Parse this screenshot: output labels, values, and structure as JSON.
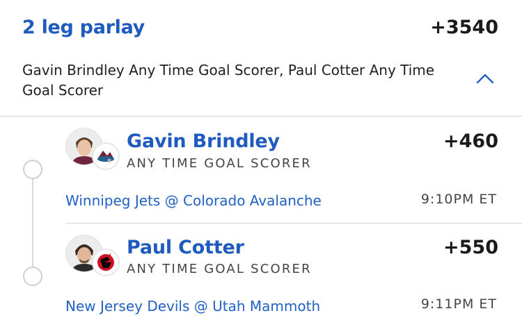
{
  "bet": {
    "title": "2 leg parlay",
    "odds": "+3540",
    "description": "Gavin Brindley Any Time Goal Scorer, Paul Cotter Any Time Goal Scorer"
  },
  "legs": [
    {
      "player": "Gavin Brindley",
      "market": "ANY TIME GOAL SCORER",
      "odds": "+460",
      "game": "Winnipeg Jets @ Colorado Avalanche",
      "time": "9:10PM ET",
      "team_logo": "colorado-avalanche-logo",
      "team_color": "#6f263d"
    },
    {
      "player": "Paul Cotter",
      "market": "ANY TIME GOAL SCORER",
      "odds": "+550",
      "game": "New Jersey Devils @ Utah Mammoth",
      "time": "9:11PM ET",
      "team_logo": "new-jersey-devils-logo",
      "team_color": "#ce1126"
    }
  ],
  "colors": {
    "accent": "#1f5bbf",
    "link": "#2160c4",
    "divider": "#cfcfcf"
  },
  "icons": {
    "collapse": "chevron-up-icon"
  }
}
